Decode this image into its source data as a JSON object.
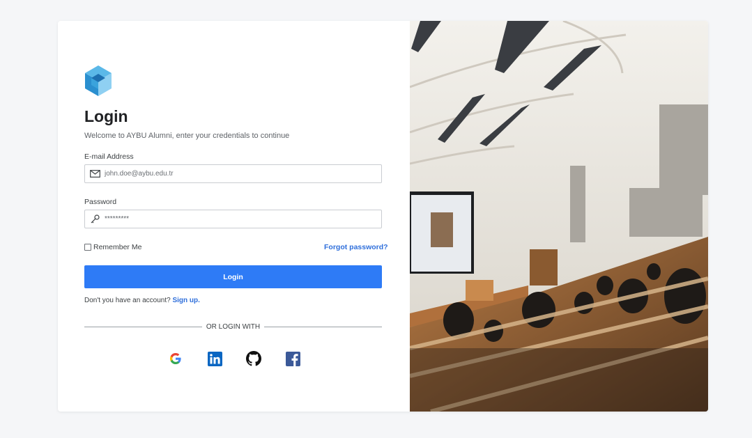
{
  "login": {
    "title": "Login",
    "subtitle": "Welcome to AYBU Alumni, enter your credentials to continue",
    "email_label": "E-mail Address",
    "email_placeholder": "john.doe@aybu.edu.tr",
    "password_label": "Password",
    "password_value": "*********",
    "remember_label": "Remember Me",
    "forgot_label": "Forgot password?",
    "submit_label": "Login",
    "no_account_text": "Don't you have an account?",
    "signup_label": "Sign up.",
    "divider_text": "OR LOGIN WITH"
  },
  "social": [
    {
      "icon": "google-icon"
    },
    {
      "icon": "linkedin-icon"
    },
    {
      "icon": "github-icon"
    },
    {
      "icon": "facebook-icon"
    }
  ],
  "colors": {
    "primary": "#2e7bf6",
    "link": "#2f6fdb",
    "linkedin": "#0a66c2",
    "facebook": "#3b5998"
  }
}
